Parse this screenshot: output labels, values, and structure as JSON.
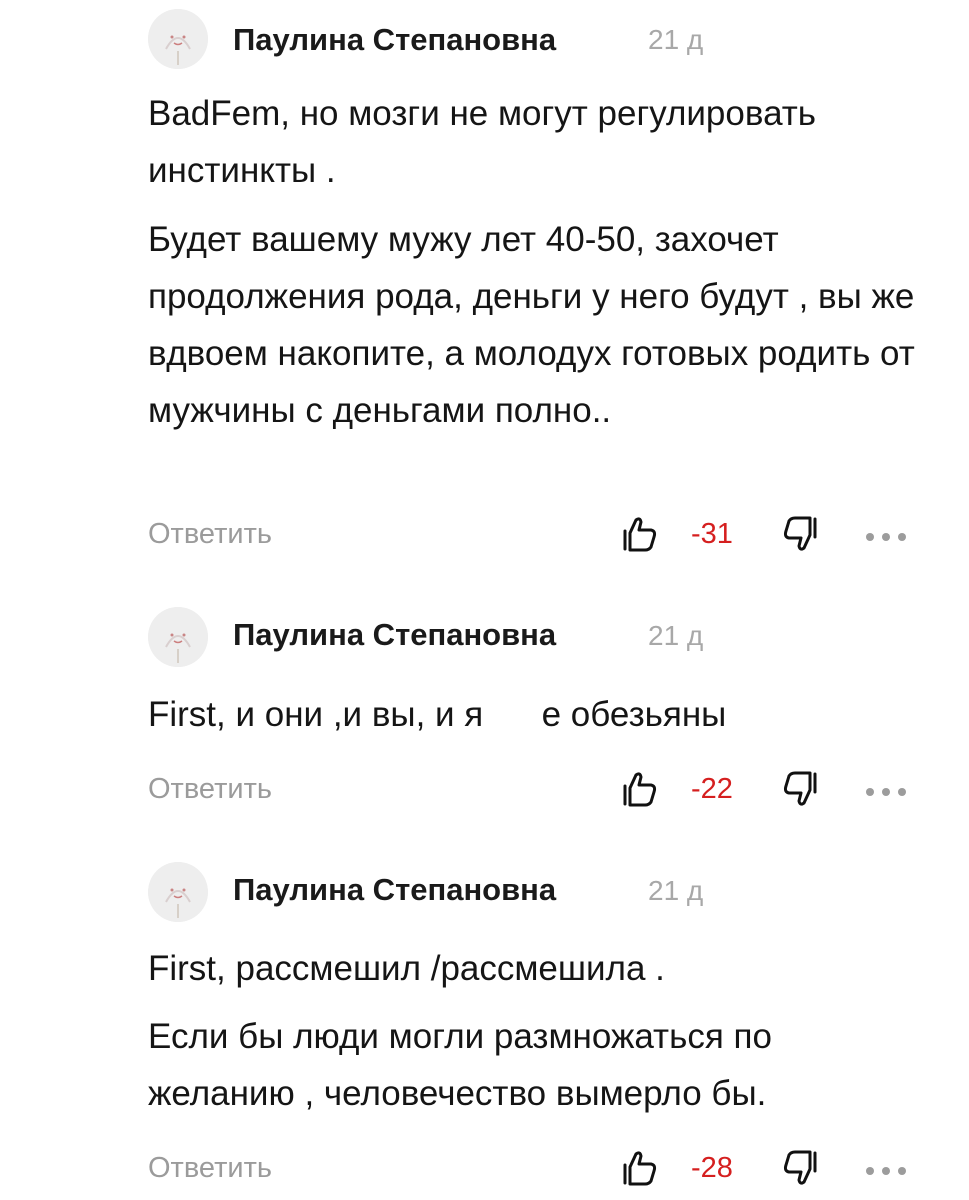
{
  "comments": [
    {
      "author": "Паулина Степановна",
      "age": "21 д",
      "paragraphs": [
        "BadFem, но мозги не могут регулировать инстинкты .",
        "Будет вашему мужу лет 40-50, захочет продолжения рода, деньги у него будут , вы же вдвоем накопите, а молодух готовых родить от мужчины с деньгами полно.."
      ],
      "reply_label": "Ответить",
      "score": "-31"
    },
    {
      "author": "Паулина Степановна",
      "age": "21 д",
      "paragraphs": [
        "First, и они ,и вы, и я      е обезьяны"
      ],
      "reply_label": "Ответить",
      "score": "-22"
    },
    {
      "author": "Паулина Степановна",
      "age": "21 д",
      "paragraphs": [
        "First, рассмешил /рассмешила .",
        "Если бы люди могли размножаться по желанию , человечество вымерло бы."
      ],
      "reply_label": "Ответить",
      "score": "-28"
    }
  ],
  "icons": {
    "like": "thumbs-up-outline-icon",
    "dislike": "thumbs-down-outline-icon",
    "more": "more-dots-icon"
  },
  "colors": {
    "score_negative": "#d51f1f",
    "muted_text": "#9b9b9b"
  }
}
